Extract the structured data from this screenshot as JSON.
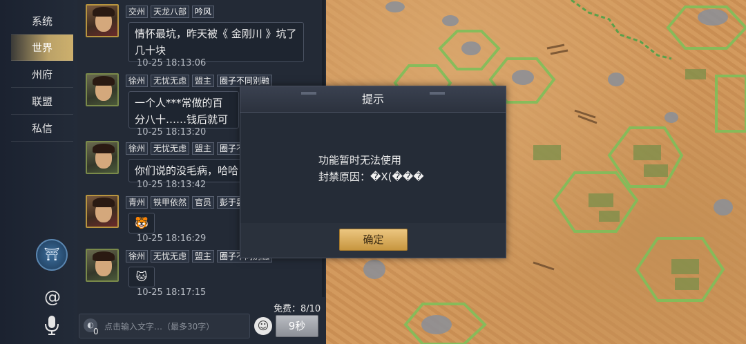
{
  "nav": {
    "items": [
      {
        "label": "系统",
        "active": false
      },
      {
        "label": "世界",
        "active": true
      },
      {
        "label": "州府",
        "active": false
      },
      {
        "label": "联盟",
        "active": false
      },
      {
        "label": "私信",
        "active": false
      }
    ],
    "emblem_icon": "realm-emblem-icon",
    "at_icon": "@"
  },
  "messages": [
    {
      "tags": [
        "交州",
        "天龙八部",
        "吟风"
      ],
      "text": "情怀最坑，昨天被《 金刚川 》坑了几十块",
      "time": "10-25 18:13:06"
    },
    {
      "tags": [
        "徐州",
        "无忧无虑",
        "盟主",
        "圈子不同别融"
      ],
      "text": "一个人***常做的百分八十……钱后就可以不做的。",
      "time": "10-25 18:13:20"
    },
    {
      "tags": [
        "徐州",
        "无忧无虑",
        "盟主",
        "圈子不同别融"
      ],
      "text": "你们说的没毛病，哈哈",
      "time": "10-25 18:13:42"
    },
    {
      "tags": [
        "青州",
        "铁甲依然",
        "官员",
        "彭于晏"
      ],
      "text": "🐯",
      "time": "10-25 18:16:29"
    },
    {
      "tags": [
        "徐州",
        "无忧无虑",
        "盟主",
        "圈子不同别融"
      ],
      "text": "🐱",
      "time": "10-25 18:17:15"
    }
  ],
  "footer": {
    "free_label": "免费：8/10",
    "input_placeholder": "点击输入文字…（最多30字）",
    "input_count": "0",
    "send_label": "9秒"
  },
  "dialog": {
    "title": "提示",
    "line1": "功能暂时无法使用",
    "line2": "封禁原因：�X(���",
    "ok_label": "确定"
  }
}
